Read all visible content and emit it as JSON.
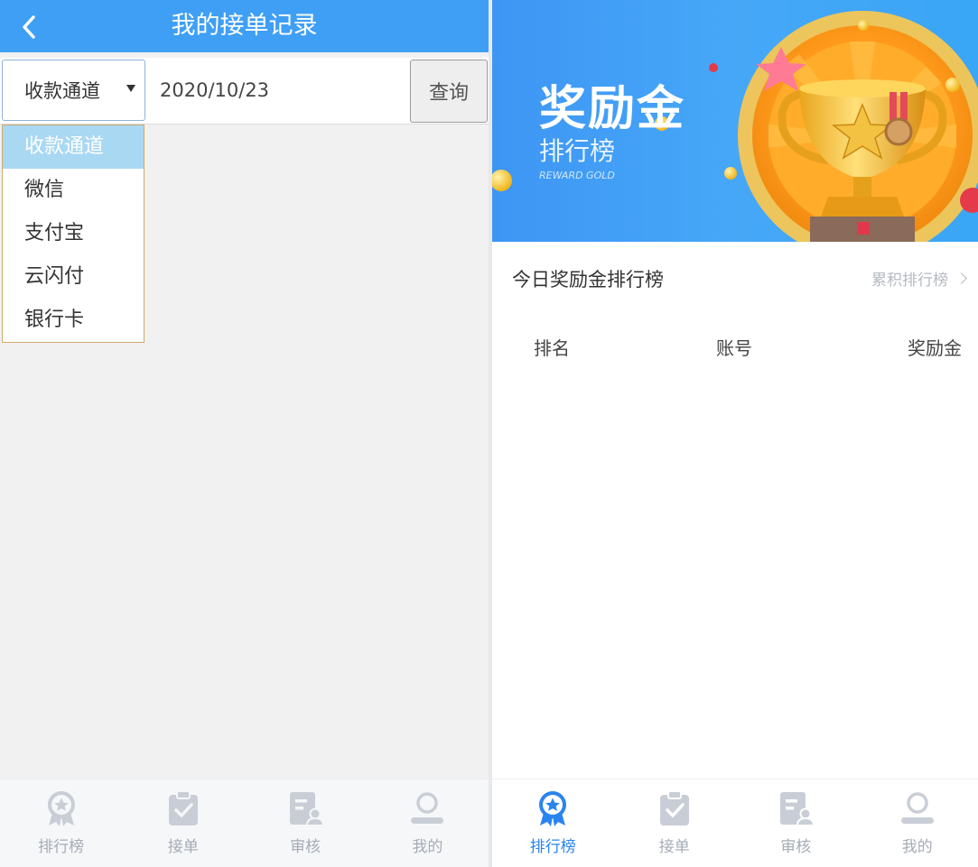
{
  "left": {
    "header": {
      "title": "我的接单记录"
    },
    "filter": {
      "channel_selected": "收款通道",
      "date_value": "2020/10/23",
      "query_label": "查询"
    },
    "dropdown": {
      "options": [
        "收款通道",
        "微信",
        "支付宝",
        "云闪付",
        "银行卡"
      ]
    },
    "tabs": [
      {
        "label": "排行榜",
        "icon": "ranking-medal-icon"
      },
      {
        "label": "接单",
        "icon": "order-clipboard-icon"
      },
      {
        "label": "审核",
        "icon": "review-document-icon"
      },
      {
        "label": "我的",
        "icon": "user-profile-icon"
      }
    ]
  },
  "right": {
    "banner": {
      "title": "奖励金",
      "subtitle": "排行榜",
      "english": "REWARD GOLD"
    },
    "section": {
      "title": "今日奖励金排行榜",
      "link": "累积排行榜"
    },
    "table": {
      "columns": [
        "排名",
        "账号",
        "奖励金"
      ]
    },
    "tabs": [
      {
        "label": "排行榜",
        "icon": "ranking-medal-icon"
      },
      {
        "label": "接单",
        "icon": "order-clipboard-icon"
      },
      {
        "label": "审核",
        "icon": "review-document-icon"
      },
      {
        "label": "我的",
        "icon": "user-profile-icon"
      }
    ]
  },
  "colors": {
    "header_blue": "#3f9ff5",
    "active_tab": "#2a84ee",
    "inactive_tab": "#c9ced6",
    "dropdown_highlight": "#a9d8f3"
  }
}
